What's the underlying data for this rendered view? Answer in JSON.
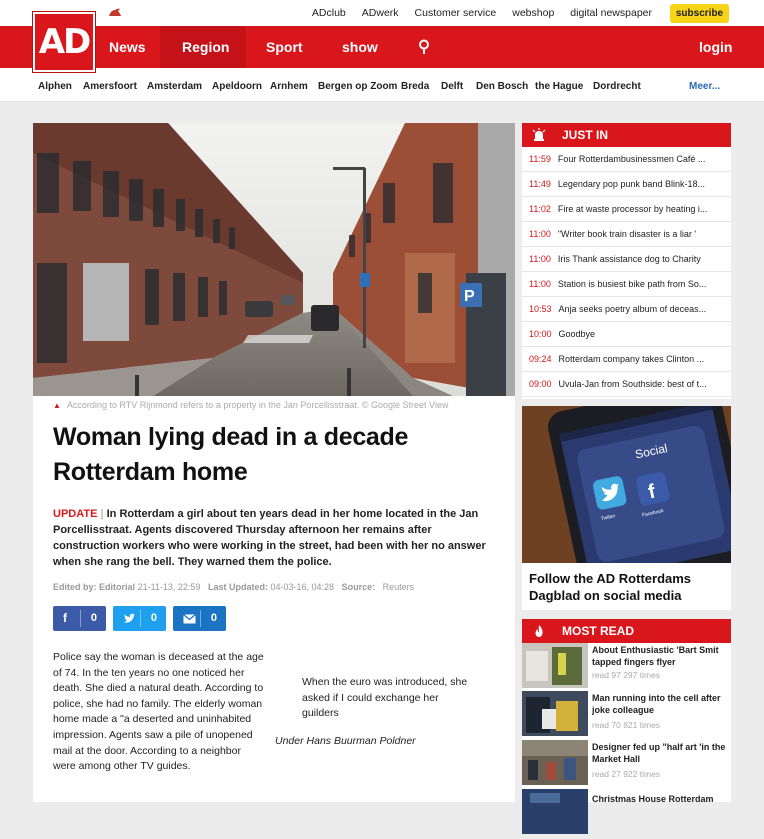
{
  "utility": {
    "links": [
      "ADclub",
      "ADwerk",
      "Customer service",
      "webshop",
      "digital newspaper"
    ],
    "subscribe": "subscribe"
  },
  "nav": {
    "logo": "AD",
    "items": [
      "News",
      "Region",
      "Sport",
      "show"
    ],
    "login": "login"
  },
  "cities": [
    "Alphen",
    "Amersfoort",
    "Amsterdam",
    "Apeldoorn",
    "Arnhem",
    "Bergen op Zoom",
    "Breda",
    "Delft",
    "Den Bosch",
    "the Hague",
    "Dordrecht"
  ],
  "cities_more": "Meer...",
  "article": {
    "caption": "According to RTV Rijnmond refers to a property in the Jan Porcellisstraat. © Google Street View",
    "headline": "Woman lying dead in a decade Rotterdam home",
    "update_label": "UPDATE",
    "lead": "In Rotterdam a girl about ten years dead in her home located in the Jan Porcellisstraat. Agents discovered Thursday afternoon her remains after construction workers who were working in the street, had been with her no answer when she rang the bell. They warned them the police.",
    "meta": {
      "edited_label": "Edited by:",
      "edited_by": "Editorial",
      "edited_date": "21-11-13, 22:59",
      "updated_label": "Last Updated:",
      "updated_date": "04-03-16, 04:28",
      "source_label": "Source:",
      "source": "Reuters"
    },
    "share": [
      {
        "icon": "facebook-icon",
        "count": "0",
        "color": "#3b5ba8"
      },
      {
        "icon": "twitter-icon",
        "count": "0",
        "color": "#1ea0ee"
      },
      {
        "icon": "mail-icon",
        "count": "0",
        "color": "#1b73c4"
      }
    ],
    "body": "Police say the woman is deceased at the age of 74. In the ten years no one noticed her death. She died a natural death. According to police, she had no family. The elderly woman home made a \"a deserted and uninhabited impression. Agents saw a pile of unopened mail at the door. According to a neighbor were among other TV guides.",
    "quote": "When the euro was introduced, she asked if I could exchange her guilders",
    "quote_source": "Under Hans Buurman Poldner"
  },
  "just_in": {
    "title": "JUST IN",
    "items": [
      {
        "time": "11:59",
        "text": "Four Rotterdambusinessmen Café ..."
      },
      {
        "time": "11:49",
        "text": "Legendary pop punk band Blink-18..."
      },
      {
        "time": "11:02",
        "text": "Fire at waste processor by heating i..."
      },
      {
        "time": "11:00",
        "text": "\"Writer book train disaster is a liar '"
      },
      {
        "time": "11:00",
        "text": "Iris Thank assistance dog to Charity"
      },
      {
        "time": "11:00",
        "text": "Station is busiest bike path from So..."
      },
      {
        "time": "10:53",
        "text": "Anja seeks poetry album of deceas..."
      },
      {
        "time": "10:00",
        "text": "Goodbye"
      },
      {
        "time": "09:24",
        "text": "Rotterdam company takes Clinton ..."
      },
      {
        "time": "09:00",
        "text": "Uvula-Jan from Southside: best of t..."
      }
    ]
  },
  "social": {
    "phone_text": "Social",
    "twitter_label": "Twitter",
    "facebook_label": "Facebook",
    "title": "Follow the AD Rotterdams Dagblad on social media"
  },
  "most_read": {
    "title": "MOST READ",
    "items": [
      {
        "title": "About Enthusiastic 'Bart Smit tapped fingers flyer",
        "reads": "read 97 297 times"
      },
      {
        "title": "Man running into the cell after joke colleague",
        "reads": "read 70 821 times"
      },
      {
        "title": "Designer fed up \"half art 'in the Market Hall",
        "reads": "read 27 922 times"
      },
      {
        "title": "Christmas House Rotterdam",
        "reads": ""
      }
    ]
  },
  "colors": {
    "brand_red": "#d8161c",
    "subscribe_yellow": "#f7d417",
    "link_blue": "#2a6bb6"
  }
}
